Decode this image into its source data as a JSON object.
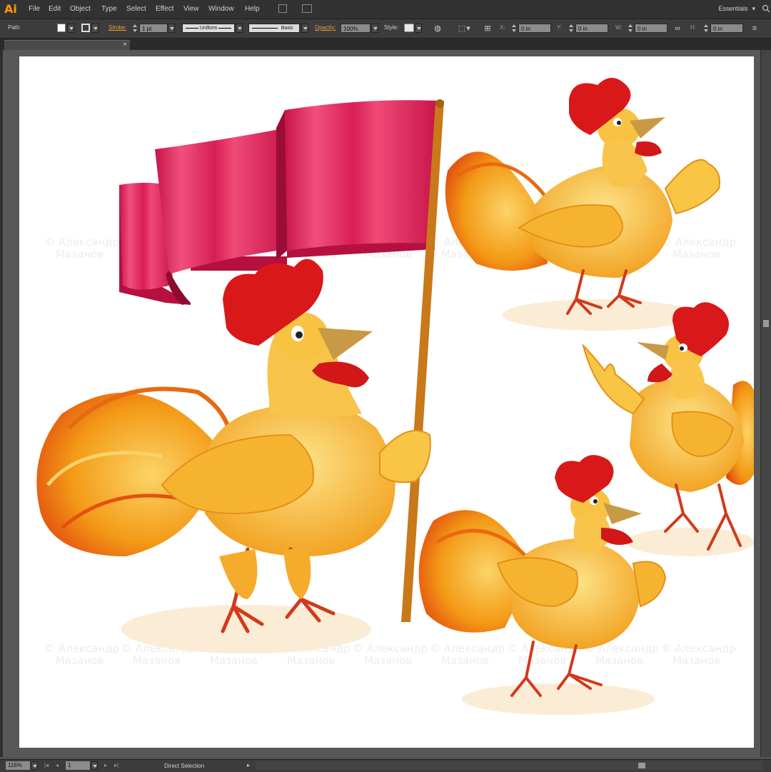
{
  "app": {
    "logo": "Ai"
  },
  "menu": {
    "items": [
      "File",
      "Edit",
      "Object",
      "Type",
      "Select",
      "Effect",
      "View",
      "Window",
      "Help"
    ],
    "workspace": "Essentials"
  },
  "control_bar": {
    "selection_type": "Path",
    "stroke_label": "Stroke:",
    "stroke_weight": "1 pt",
    "profile_label": "Uniform",
    "brush_label": "Basic",
    "opacity_label": "Opacity:",
    "opacity_value": "100%",
    "style_label": "Style:",
    "x_label": "X:",
    "x_value": "0 in",
    "y_label": "Y:",
    "y_value": "0 in",
    "w_label": "W:",
    "w_value": "0 in",
    "h_label": "H:",
    "h_value": "0 in"
  },
  "document": {
    "close_glyph": "×"
  },
  "artwork": {
    "watermark_line1": "© Александр",
    "watermark_line2": "Мазанов",
    "colors": {
      "flag": "#e0245e",
      "flag_dark": "#b8123f",
      "pole": "#c9781a",
      "comb": "#d9181a",
      "body": "#f7b733",
      "body_light": "#fde48a",
      "tail": "#f28a12",
      "beak": "#c99a45",
      "legs": "#d23a1a",
      "shadow": "#f9e6c8"
    }
  },
  "status_bar": {
    "zoom": "116%",
    "page": "1",
    "tool_status": "Direct Selection"
  }
}
